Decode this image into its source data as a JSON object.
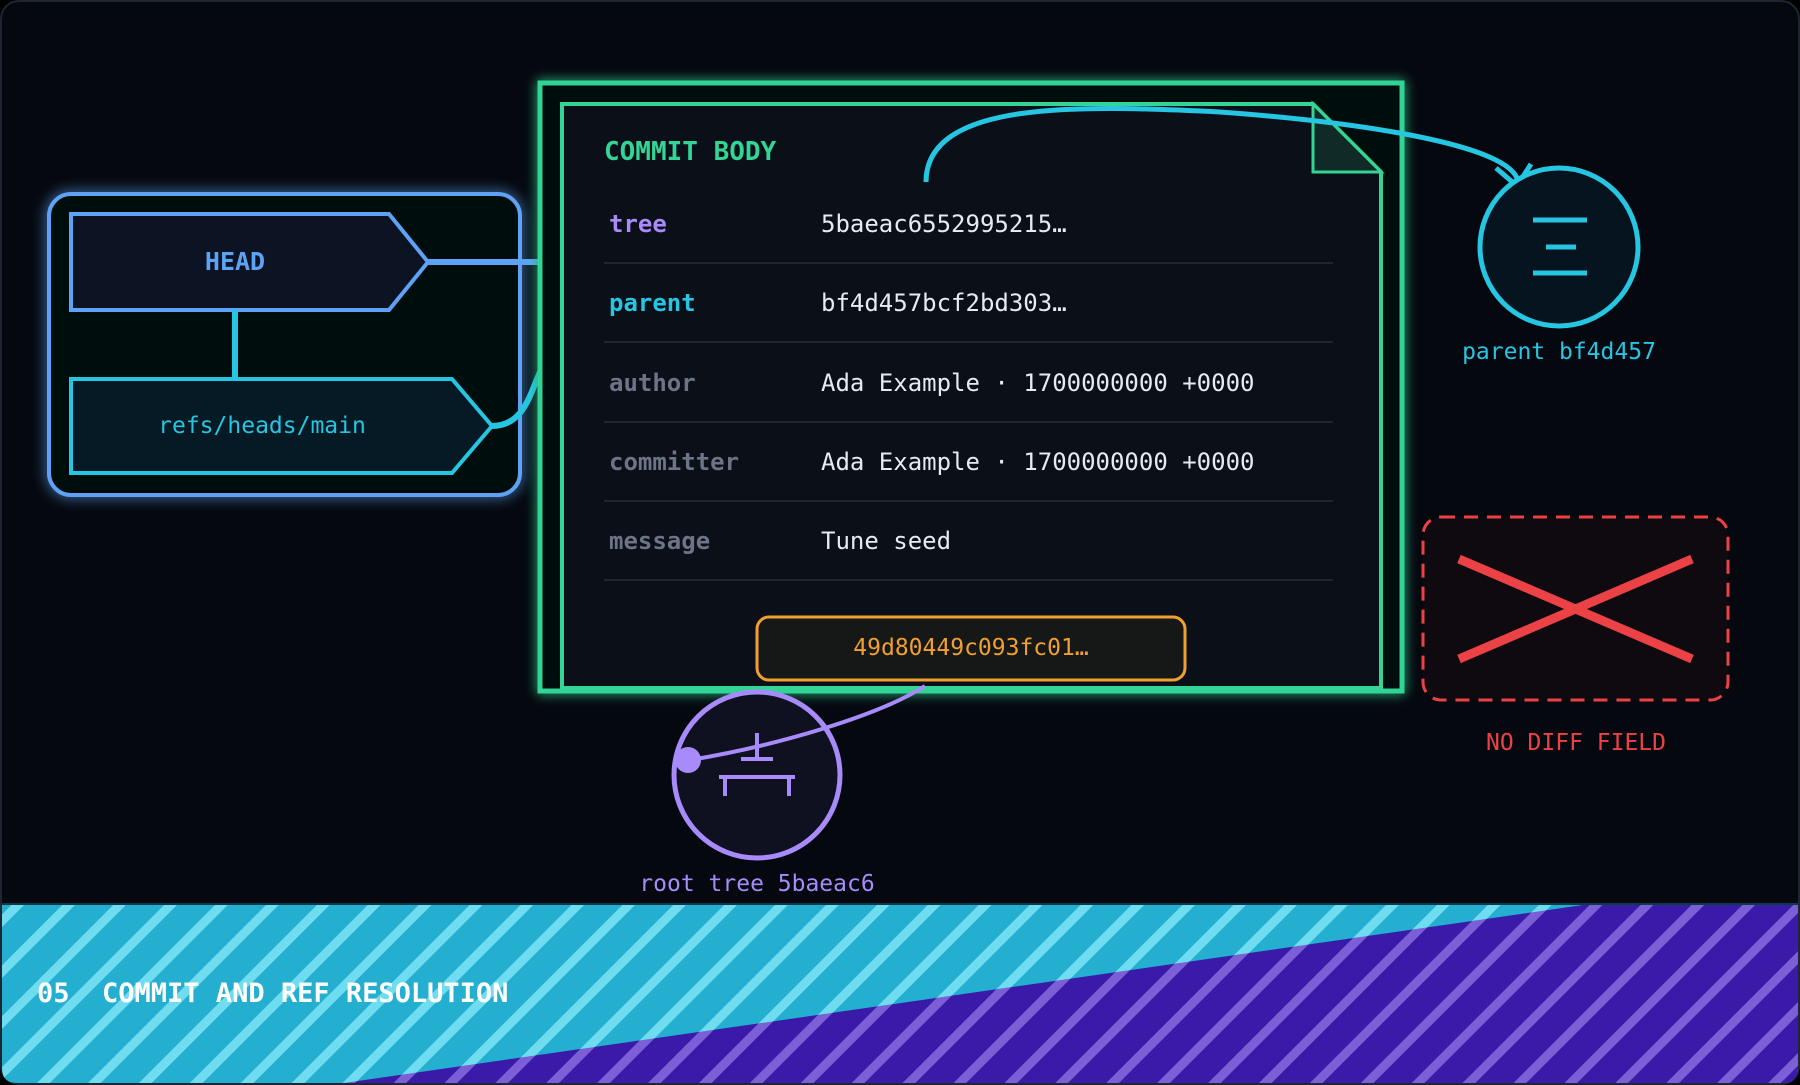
{
  "refs": {
    "head_label": "HEAD",
    "branch_label": "refs/heads/main"
  },
  "commit": {
    "title": "COMMIT BODY",
    "fields": [
      {
        "key": "tree",
        "value": "5baeac6552995215…"
      },
      {
        "key": "parent",
        "value": "bf4d457bcf2bd303…"
      },
      {
        "key": "author",
        "value": "Ada Example · 1700000000 +0000"
      },
      {
        "key": "committer",
        "value": "Ada Example · 1700000000 +0000"
      },
      {
        "key": "message",
        "value": "Tune seed"
      }
    ],
    "hash": "49d80449c093fc01…"
  },
  "nodes": {
    "parent_label": "parent bf4d457",
    "tree_label": "root tree 5baeac6",
    "no_diff_label": "NO DIFF FIELD"
  },
  "footer": {
    "title": "05  COMMIT AND REF RESOLUTION"
  },
  "icons": [
    "commit-list-icon",
    "tree-hierarchy-icon",
    "cross-icon"
  ],
  "colors": {
    "background": "#05080f",
    "head_blue": "#5ea2f5",
    "branch_cyan": "#26c5e2",
    "commit_green": "#33d495",
    "tree_purple": "#a78bfa",
    "hash_orange": "#f0a030",
    "error_red": "#ec4245",
    "footer_cyan": "#24afd1",
    "footer_purple": "#3a1aa8"
  }
}
